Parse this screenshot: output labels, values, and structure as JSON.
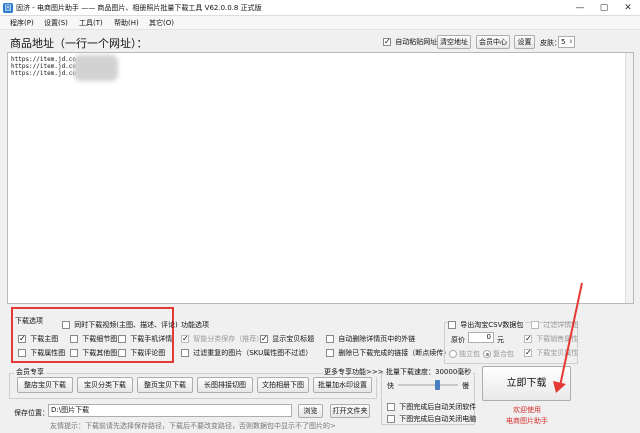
{
  "window": {
    "icon_text": "固",
    "title": "固济 - 电商图片助手 —— 商品图片、相册照片批量下载工具 V62.0.0.8 正式版",
    "controls": [
      "—",
      "▢",
      "✕"
    ]
  },
  "menu": [
    "程序(P)",
    "设置(S)",
    "工具(T)",
    "帮助(H)",
    "其它(O)"
  ],
  "url_header": {
    "label": "商品地址（一行一个网址）：",
    "auto_paste_label": "自动粘贴网址",
    "clear_label": "清空地址",
    "member_label": "会员中心",
    "settings_label": "设置",
    "skin_label": "皮肤：",
    "skin_value": "5"
  },
  "url_list": [
    "https://item.jd.co",
    "https://item.jd.co",
    "https://item.jd.co"
  ],
  "download_options": {
    "title": "下载选项",
    "items": [
      {
        "label": "同时下载视频(主图、描述、评论)",
        "checked": false
      },
      {
        "label": "下载主图",
        "checked": true
      },
      {
        "label": "下载细节图",
        "checked": false
      },
      {
        "label": "下载手机详情",
        "checked": false
      },
      {
        "label": "下载属性图",
        "checked": false
      },
      {
        "label": "下载其他图",
        "checked": false
      },
      {
        "label": "下载评论图",
        "checked": false
      }
    ]
  },
  "feature_options": {
    "title": "功能选项",
    "items": [
      {
        "label": "智能分类保存（推荐）",
        "checked": true,
        "dim": true
      },
      {
        "label": "显示宝贝标题",
        "checked": true,
        "dim": false
      },
      {
        "label": "自动删除详情页中的外链",
        "checked": false,
        "dim": false
      },
      {
        "label": "过滤重复的图片（SKU属性图不过滤）",
        "checked": false,
        "dim": false
      },
      {
        "label": "删除已下载完成的链接（断点续传）",
        "checked": false,
        "dim": false
      }
    ]
  },
  "csv_options": {
    "export_label": "导出淘宝CSV数据包",
    "filter_label": "过滤详情图",
    "price_label": "原价",
    "price_value": "0",
    "currency": "元",
    "download_sales_label": "下载销售属性",
    "single_label": "独立包",
    "merge_label": "复合包",
    "download_fields_label": "下载宝贝属性"
  },
  "member": {
    "title": "会员专享",
    "more_label": "更多专享功能>>>",
    "buttons": [
      "整店宝贝下载",
      "宝贝分类下载",
      "整页宝贝下载",
      "长图排接切图",
      "文拍相册下图",
      "批量加水印设置"
    ]
  },
  "speed": {
    "label": "批量下载速度：30000毫秒",
    "fast": "快",
    "slow": "慢",
    "speed_pct": 68,
    "auto_close_app": "下图完成后自动关闭软件",
    "auto_shutdown": "下图完成后自动关闭电脑"
  },
  "save": {
    "label": "保存位置：",
    "path": "D:\\图片下载",
    "browse_label": "浏览",
    "open_label": "打开文件夹",
    "hint": "友情提示：下载前请先选择保存路径，下载后不要改变路径，否则数据包中显示不了图片的>"
  },
  "action": {
    "download_label": "立即下载",
    "welcome_line1": "欢迎使用",
    "welcome_line2": "电商图片助手"
  },
  "colors": {
    "highlight_red": "#e53935",
    "link_red": "#d32f2f"
  }
}
